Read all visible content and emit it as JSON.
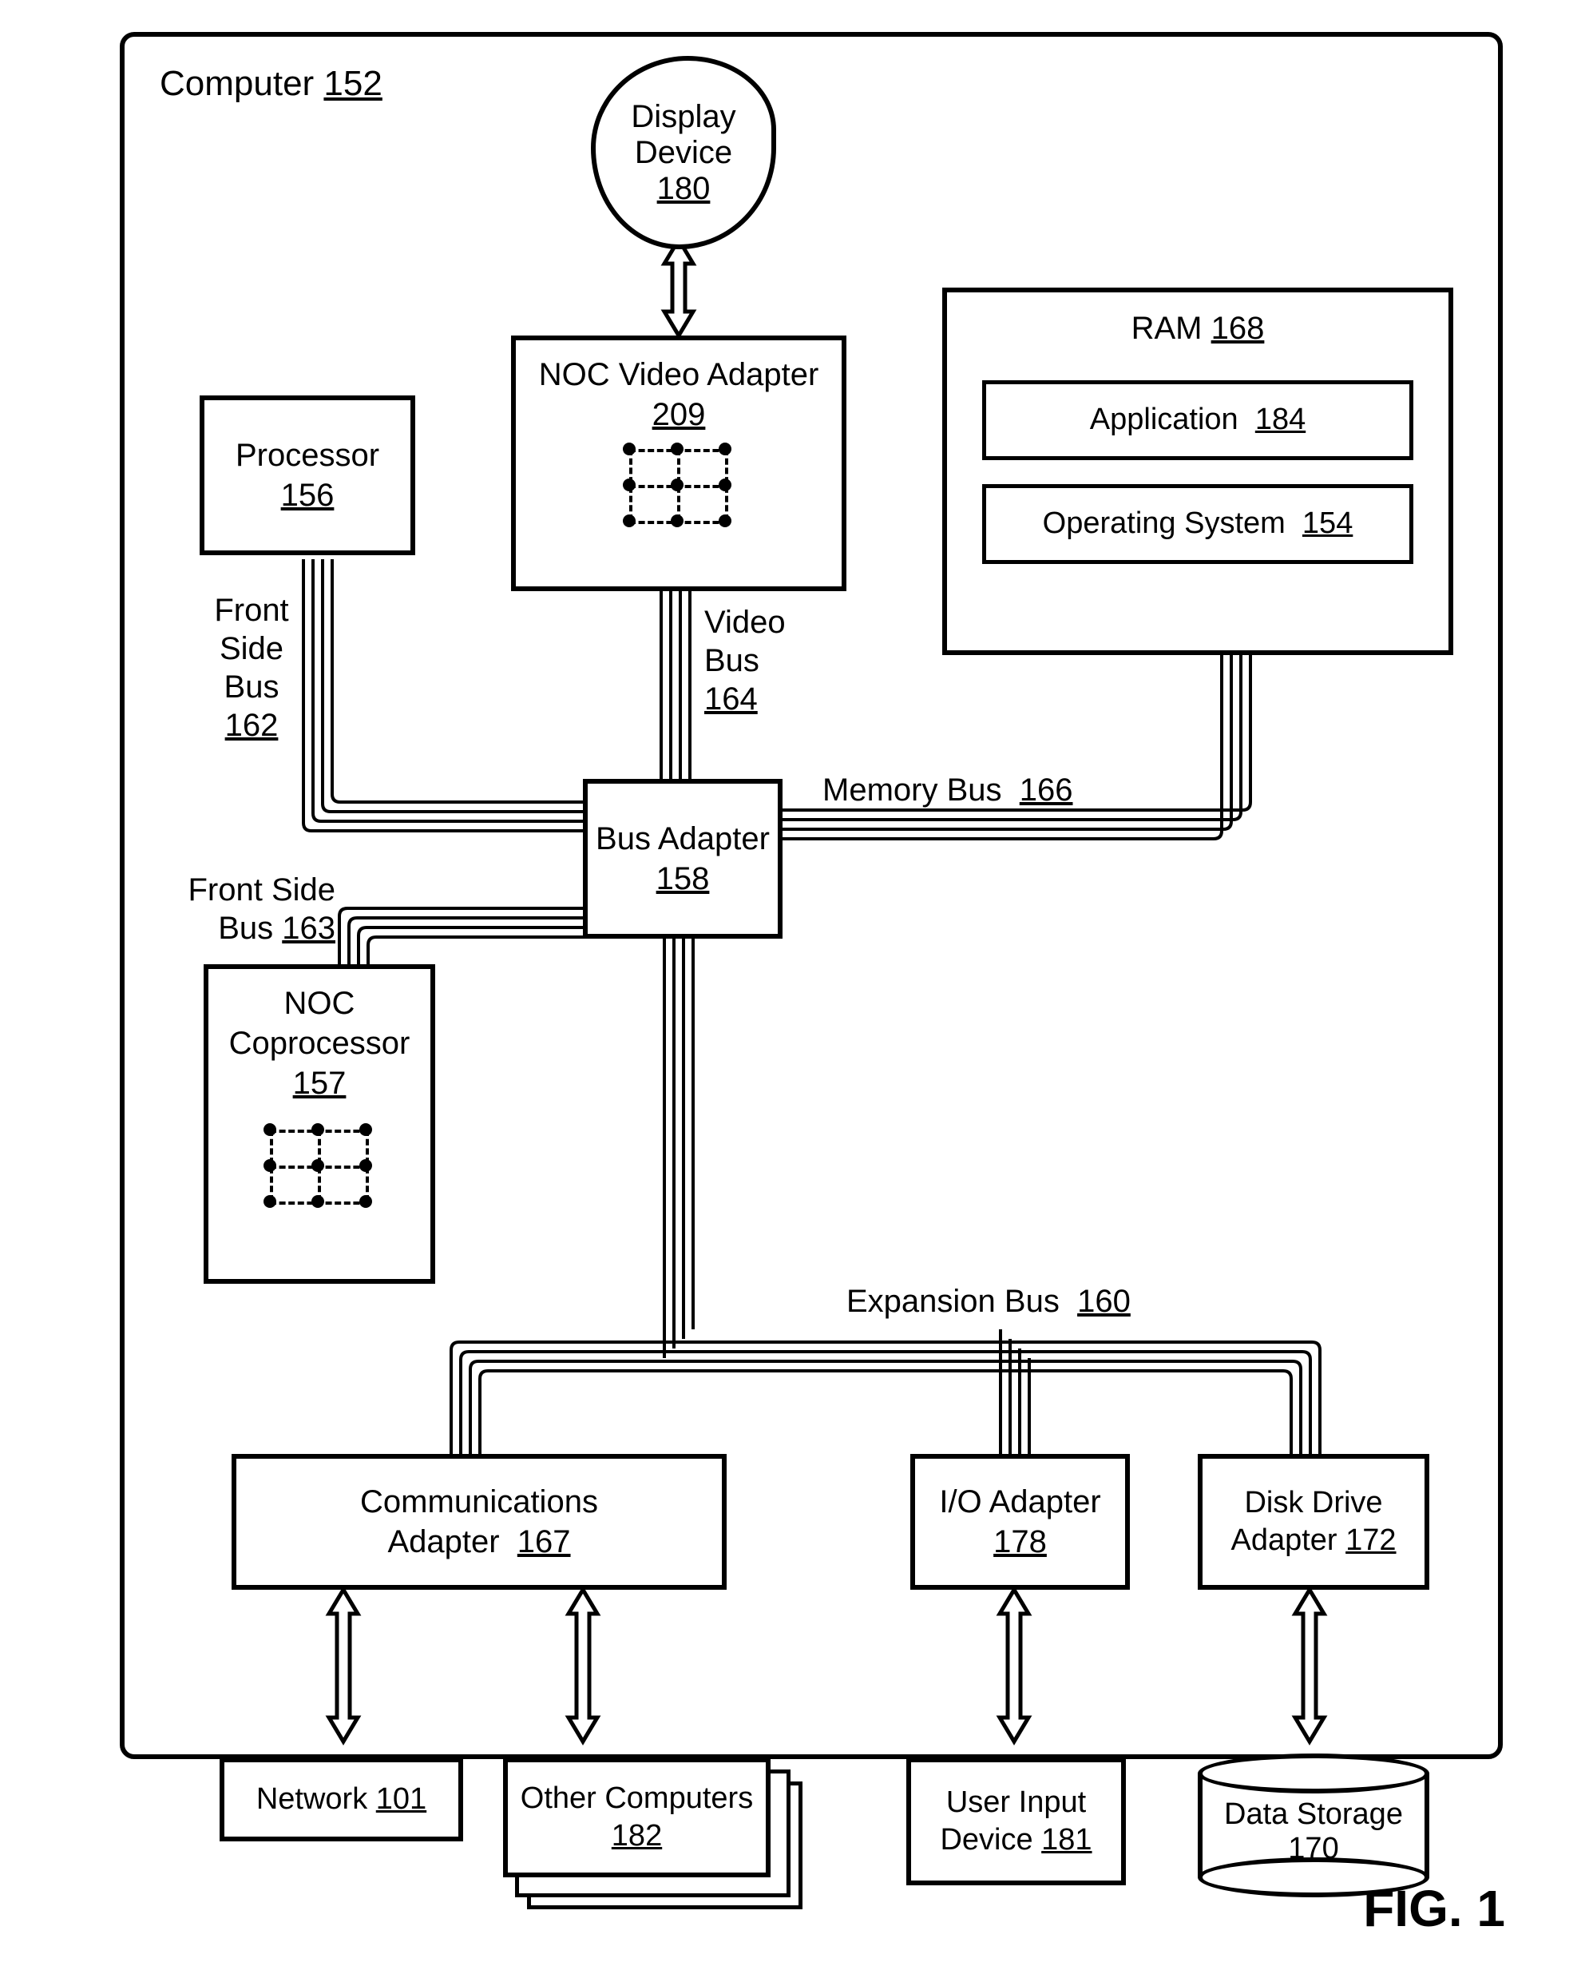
{
  "figure_label": "FIG. 1",
  "computer": {
    "label": "Computer",
    "ref": "152"
  },
  "display_device": {
    "label": "Display Device",
    "ref": "180"
  },
  "noc_video_adapter": {
    "label": "NOC Video Adapter",
    "ref": "209"
  },
  "processor": {
    "label": "Processor",
    "ref": "156"
  },
  "ram": {
    "label": "RAM",
    "ref": "168",
    "application": {
      "label": "Application",
      "ref": "184"
    },
    "os": {
      "label": "Operating System",
      "ref": "154"
    }
  },
  "bus_adapter": {
    "label": "Bus Adapter",
    "ref": "158"
  },
  "noc_coprocessor": {
    "label": "NOC Coprocessor",
    "ref": "157"
  },
  "comm_adapter": {
    "label": "Communications Adapter",
    "ref": "167"
  },
  "io_adapter": {
    "label": "I/O Adapter",
    "ref": "178"
  },
  "disk_drive_adapter": {
    "label": "Disk Drive Adapter",
    "ref": "172"
  },
  "network": {
    "label": "Network",
    "ref": "101"
  },
  "other_computers": {
    "label": "Other Computers",
    "ref": "182"
  },
  "user_input_device": {
    "label": "User Input Device",
    "ref": "181"
  },
  "data_storage": {
    "label": "Data Storage",
    "ref": "170"
  },
  "buses": {
    "front_side_bus": {
      "label": "Front Side Bus",
      "ref": "162"
    },
    "front_side_bus2": {
      "label": "Front Side Bus",
      "ref": "163"
    },
    "video_bus": {
      "label": "Video Bus",
      "ref": "164"
    },
    "memory_bus": {
      "label": "Memory Bus",
      "ref": "166"
    },
    "expansion_bus": {
      "label": "Expansion Bus",
      "ref": "160"
    }
  }
}
